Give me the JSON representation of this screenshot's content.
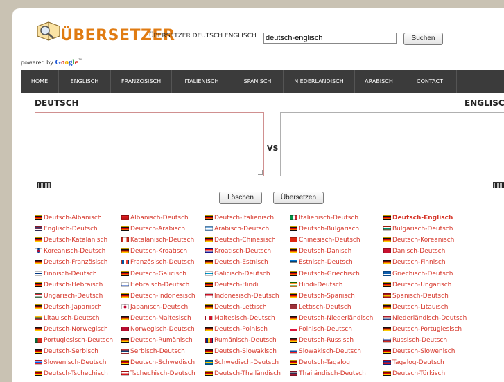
{
  "header": {
    "logo": "ÜBERSETZER",
    "tagline": "ÜBERSETZER DEUTSCH ENGLISCH",
    "search_value": "deutsch-englisch",
    "search_button": "Suchen",
    "powered_prefix": "powered by",
    "powered_brand": [
      "G",
      "o",
      "o",
      "g",
      "l",
      "e"
    ],
    "powered_tm": "™"
  },
  "nav": [
    "HOME",
    "ENGLISCH",
    "FRANZOSISCH",
    "ITALIENISCH",
    "SPANISCH",
    "NIEDERLANDISCH",
    "ARABISCH",
    "CONTACT"
  ],
  "translator": {
    "source_label": "DEUTSCH",
    "target_label": "ENGLISCH",
    "vs": "VS",
    "clear_button": "Löschen",
    "translate_button": "Übersetzen"
  },
  "colors": {
    "accent": "#e07b12",
    "link": "#d6362a",
    "nav_bg": "#3b3b3b"
  },
  "language_links": [
    [
      {
        "label": "Deutsch-Albanisch",
        "flag": "de-flag"
      },
      {
        "label": "Englisch-Deutsch",
        "flag": "us-flag"
      },
      {
        "label": "Deutsch-Katalanisch",
        "flag": "de-flag"
      },
      {
        "label": "Koreanisch-Deutsch",
        "flag": "kr-flag"
      },
      {
        "label": "Deutsch-Französisch",
        "flag": "de-flag"
      },
      {
        "label": "Finnisch-Deutsch",
        "flag": "fi-flag"
      },
      {
        "label": "Deutsch-Hebräisch",
        "flag": "de-flag"
      },
      {
        "label": "Ungarisch-Deutsch",
        "flag": "hu-flag"
      },
      {
        "label": "Deutsch-Japanisch",
        "flag": "de-flag"
      },
      {
        "label": "Litauisch-Deutsch",
        "flag": "lt-flag"
      },
      {
        "label": "Deutsch-Norwegisch",
        "flag": "de-flag"
      },
      {
        "label": "Portugiesisch-Deutsch",
        "flag": "pt-flag"
      },
      {
        "label": "Deutsch-Serbisch",
        "flag": "de-flag"
      },
      {
        "label": "Slowenisch-Deutsch",
        "flag": "si-flag"
      },
      {
        "label": "Deutsch-Tschechisch",
        "flag": "de-flag"
      }
    ],
    [
      {
        "label": "Albanisch-Deutsch",
        "flag": "al-flag"
      },
      {
        "label": "Deutsch-Arabisch",
        "flag": "de-flag"
      },
      {
        "label": "Katalanisch-Deutsch",
        "flag": "ca-flag"
      },
      {
        "label": "Deutsch-Kroatisch",
        "flag": "de-flag"
      },
      {
        "label": "Französisch-Deutsch",
        "flag": "fr-flag"
      },
      {
        "label": "Deutsch-Galicisch",
        "flag": "de-flag"
      },
      {
        "label": "Hebräisch-Deutsch",
        "flag": "il-flag"
      },
      {
        "label": "Deutsch-Indonesisch",
        "flag": "de-flag"
      },
      {
        "label": "Japanisch-Deutsch",
        "flag": "jp-flag"
      },
      {
        "label": "Deutsch-Maltesisch",
        "flag": "de-flag"
      },
      {
        "label": "Norwegisch-Deutsch",
        "flag": "no-flag"
      },
      {
        "label": "Deutsch-Rumänisch",
        "flag": "de-flag"
      },
      {
        "label": "Serbisch-Deutsch",
        "flag": "rs-flag"
      },
      {
        "label": "Deutsch-Schwedisch",
        "flag": "de-flag"
      },
      {
        "label": "Tschechisch-Deutsch",
        "flag": "cz-flag"
      }
    ],
    [
      {
        "label": "Deutsch-Italienisch",
        "flag": "de-flag"
      },
      {
        "label": "Arabisch-Deutsch",
        "flag": "ar-flag"
      },
      {
        "label": "Deutsch-Chinesisch",
        "flag": "de-flag"
      },
      {
        "label": "Kroatisch-Deutsch",
        "flag": "hr-flag"
      },
      {
        "label": "Deutsch-Estnisch",
        "flag": "de-flag"
      },
      {
        "label": "Galicisch-Deutsch",
        "flag": "gl-flag"
      },
      {
        "label": "Deutsch-Hindi",
        "flag": "de-flag"
      },
      {
        "label": "Indonesisch-Deutsch",
        "flag": "id-flag"
      },
      {
        "label": "Deutsch-Lettisch",
        "flag": "de-flag"
      },
      {
        "label": "Maltesisch-Deutsch",
        "flag": "mt-flag"
      },
      {
        "label": "Deutsch-Polnisch",
        "flag": "de-flag"
      },
      {
        "label": "Rumänisch-Deutsch",
        "flag": "ro-flag"
      },
      {
        "label": "Deutsch-Slowakisch",
        "flag": "de-flag"
      },
      {
        "label": "Schwedisch-Deutsch",
        "flag": "se-flag"
      },
      {
        "label": "Deutsch-Thailändisch",
        "flag": "de-flag"
      }
    ],
    [
      {
        "label": "Italienisch-Deutsch",
        "flag": "it-flag"
      },
      {
        "label": "Deutsch-Bulgarisch",
        "flag": "de-flag"
      },
      {
        "label": "Chinesisch-Deutsch",
        "flag": "cn-flag"
      },
      {
        "label": "Deutsch-Dänisch",
        "flag": "de-flag"
      },
      {
        "label": "Estnisch-Deutsch",
        "flag": "ee-flag"
      },
      {
        "label": "Deutsch-Griechisch",
        "flag": "de-flag"
      },
      {
        "label": "Hindi-Deutsch",
        "flag": "in-flag"
      },
      {
        "label": "Deutsch-Spanisch",
        "flag": "de-flag"
      },
      {
        "label": "Lettisch-Deutsch",
        "flag": "lv-flag"
      },
      {
        "label": "Deutsch-Niederländisch",
        "flag": "de-flag"
      },
      {
        "label": "Polnisch-Deutsch",
        "flag": "pl-flag"
      },
      {
        "label": "Deutsch-Russisch",
        "flag": "de-flag"
      },
      {
        "label": "Slowakisch-Deutsch",
        "flag": "sk-flag"
      },
      {
        "label": "Deutsch-Tagalog",
        "flag": "de-flag"
      },
      {
        "label": "Thailändisch-Deutsch",
        "flag": "th-flag"
      }
    ],
    [
      {
        "label": "Deutsch-Englisch",
        "flag": "de-flag",
        "bold": true
      },
      {
        "label": "Bulgarisch-Deutsch",
        "flag": "bg-flag"
      },
      {
        "label": "Deutsch-Koreanisch",
        "flag": "de-flag"
      },
      {
        "label": "Dänisch-Deutsch",
        "flag": "dk-flag"
      },
      {
        "label": "Deutsch-Finnisch",
        "flag": "de-flag"
      },
      {
        "label": "Griechisch-Deutsch",
        "flag": "gr-flag"
      },
      {
        "label": "Deutsch-Ungarisch",
        "flag": "de-flag"
      },
      {
        "label": "Spanisch-Deutsch",
        "flag": "es-flag"
      },
      {
        "label": "Deutsch-Litauisch",
        "flag": "de-flag"
      },
      {
        "label": "Niederländisch-Deutsch",
        "flag": "nl-flag"
      },
      {
        "label": "Deutsch-Portugiesisch",
        "flag": "de-flag"
      },
      {
        "label": "Russisch-Deutsch",
        "flag": "ru-flag"
      },
      {
        "label": "Deutsch-Slowenisch",
        "flag": "de-flag"
      },
      {
        "label": "Tagalog-Deutsch",
        "flag": "ph-flag"
      },
      {
        "label": "Deutsch-Türkisch",
        "flag": "de-flag"
      }
    ]
  ]
}
